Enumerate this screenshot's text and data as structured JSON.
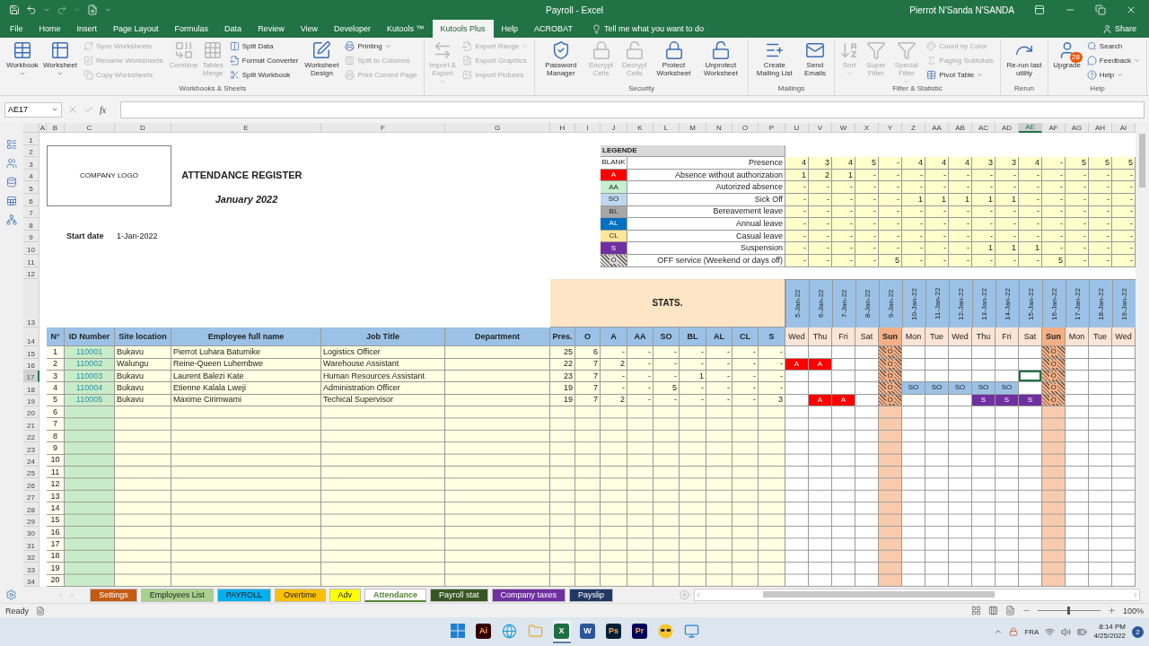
{
  "title_bar": {
    "title": "Payroll  -  Excel",
    "user": "Pierrot N'Sanda N'SANDA"
  },
  "menu_tabs": [
    {
      "label": "File",
      "selected": false
    },
    {
      "label": "Home",
      "selected": false
    },
    {
      "label": "Insert",
      "selected": false
    },
    {
      "label": "Page Layout",
      "selected": false
    },
    {
      "label": "Formulas",
      "selected": false
    },
    {
      "label": "Data",
      "selected": false
    },
    {
      "label": "Review",
      "selected": false
    },
    {
      "label": "View",
      "selected": false
    },
    {
      "label": "Developer",
      "selected": false
    },
    {
      "label": "Kutools ™",
      "selected": false
    },
    {
      "label": "Kutools Plus",
      "selected": true
    },
    {
      "label": "Help",
      "selected": false
    },
    {
      "label": "ACROBAT",
      "selected": false
    }
  ],
  "tell_me": "Tell me what you want to do",
  "share": "Share",
  "ribbon": [
    {
      "label": "Workbooks & Sheets",
      "controls": [
        {
          "kind": "large",
          "label": "Workbook",
          "disabled": false,
          "dropdown": true
        },
        {
          "kind": "large",
          "label": "Worksheet",
          "disabled": false,
          "dropdown": true
        },
        {
          "kind": "stack",
          "items": [
            {
              "label": "Sync Worksheets",
              "disabled": true,
              "dropdown": false
            },
            {
              "label": "Rename Worksheets",
              "disabled": true,
              "dropdown": false
            },
            {
              "label": "Copy Worksheets",
              "disabled": true,
              "dropdown": false
            }
          ]
        },
        {
          "kind": "large",
          "label": "Combine",
          "disabled": true,
          "dropdown": false
        },
        {
          "kind": "large",
          "label": "Tables Merge",
          "disabled": true,
          "dropdown": false
        },
        {
          "kind": "stack",
          "items": [
            {
              "label": "Split Data",
              "disabled": false,
              "dropdown": false
            },
            {
              "label": "Format Converter",
              "disabled": false,
              "dropdown": false
            },
            {
              "label": "Split Workbook",
              "disabled": false,
              "dropdown": false
            }
          ]
        },
        {
          "kind": "large",
          "label": "Worksheet Design",
          "disabled": false,
          "dropdown": false
        },
        {
          "kind": "stack",
          "items": [
            {
              "label": "Printing",
              "disabled": false,
              "dropdown": true
            },
            {
              "label": "Split to Columns",
              "disabled": true,
              "dropdown": false
            },
            {
              "label": "Print Current Page",
              "disabled": true,
              "dropdown": false
            }
          ]
        }
      ]
    },
    {
      "controls": [
        {
          "kind": "large",
          "label": "Import & Export",
          "disabled": true,
          "dropdown": true
        },
        {
          "kind": "stack",
          "items": [
            {
              "label": "Export Range",
              "disabled": true,
              "dropdown": true
            },
            {
              "label": "Export Graphics",
              "disabled": true,
              "dropdown": false
            },
            {
              "label": "Import Pictures",
              "disabled": true,
              "dropdown": false
            }
          ]
        }
      ]
    },
    {
      "label": "Security",
      "controls": [
        {
          "kind": "large",
          "label": "Password Manager",
          "disabled": false,
          "dropdown": false
        },
        {
          "kind": "large",
          "label": "Encrypt Cells",
          "disabled": true,
          "dropdown": false
        },
        {
          "kind": "large",
          "label": "Decrypt Cells",
          "disabled": true,
          "dropdown": false
        },
        {
          "kind": "large",
          "label": "Protect Worksheet",
          "disabled": false,
          "dropdown": false
        },
        {
          "kind": "large",
          "label": "Unprotect Worksheet",
          "disabled": false,
          "dropdown": false
        }
      ]
    },
    {
      "label": "Mailings",
      "controls": [
        {
          "kind": "large",
          "label": "Create Mailing List",
          "disabled": false,
          "dropdown": false
        },
        {
          "kind": "large",
          "label": "Send Emails",
          "disabled": false,
          "dropdown": false
        }
      ]
    },
    {
      "label": "Filter & Statistic",
      "controls": [
        {
          "kind": "large",
          "label": "Sort",
          "disabled": true,
          "dropdown": true
        },
        {
          "kind": "large",
          "label": "Super Filter",
          "disabled": true,
          "dropdown": false
        },
        {
          "kind": "large",
          "label": "Special Filter",
          "disabled": true,
          "dropdown": true
        },
        {
          "kind": "stack",
          "items": [
            {
              "label": "Count by Color",
              "disabled": true,
              "dropdown": false
            },
            {
              "label": "Paging Subtotals",
              "disabled": true,
              "dropdown": false
            },
            {
              "label": "Pivot Table",
              "disabled": false,
              "dropdown": true
            }
          ]
        }
      ]
    },
    {
      "label": "Rerun",
      "controls": [
        {
          "kind": "large",
          "label": "Re-run last utility",
          "disabled": false,
          "dropdown": false
        }
      ]
    },
    {
      "label": "Help",
      "controls": [
        {
          "kind": "large",
          "label": "Upgrade",
          "disabled": false,
          "dropdown": false,
          "badge": "28"
        },
        {
          "kind": "stack",
          "items": [
            {
              "label": "Search",
              "disabled": false,
              "dropdown": false
            },
            {
              "label": "Feedback",
              "disabled": false,
              "dropdown": true
            },
            {
              "label": "Help",
              "disabled": false,
              "dropdown": true
            }
          ]
        }
      ]
    }
  ],
  "formula_bar": {
    "name_box": "AE17",
    "function_label": "fx"
  },
  "sheet": {
    "column_headers": [
      {
        "label": "A",
        "selected": false
      },
      {
        "label": "B",
        "selected": false
      },
      {
        "label": "C",
        "selected": false
      },
      {
        "label": "D",
        "selected": false
      },
      {
        "label": "E",
        "selected": false
      },
      {
        "label": "F",
        "selected": false
      },
      {
        "label": "G",
        "selected": false
      },
      {
        "label": "H",
        "selected": false
      },
      {
        "label": "I",
        "selected": false
      },
      {
        "label": "J",
        "selected": false
      },
      {
        "label": "K",
        "selected": false
      },
      {
        "label": "L",
        "selected": false
      },
      {
        "label": "M",
        "selected": false
      },
      {
        "label": "N",
        "selected": false
      },
      {
        "label": "O",
        "selected": false
      },
      {
        "label": "P",
        "selected": false
      },
      {
        "label": "U",
        "selected": false
      },
      {
        "label": "V",
        "selected": false
      },
      {
        "label": "W",
        "selected": false
      },
      {
        "label": "X",
        "selected": false
      },
      {
        "label": "Y",
        "selected": false
      },
      {
        "label": "Z",
        "selected": false
      },
      {
        "label": "AA",
        "selected": false
      },
      {
        "label": "AB",
        "selected": false
      },
      {
        "label": "AC",
        "selected": false
      },
      {
        "label": "AD",
        "selected": false
      },
      {
        "label": "AE",
        "selected": true
      },
      {
        "label": "AF",
        "selected": false
      },
      {
        "label": "AG",
        "selected": false
      },
      {
        "label": "AH",
        "selected": false
      },
      {
        "label": "AI",
        "selected": false
      }
    ],
    "row_headers": [
      {
        "label": "1",
        "selected": false
      },
      {
        "label": "2",
        "selected": false
      },
      {
        "label": "3",
        "selected": false
      },
      {
        "label": "4",
        "selected": false
      },
      {
        "label": "5",
        "selected": false
      },
      {
        "label": "6",
        "selected": false
      },
      {
        "label": "7",
        "selected": false
      },
      {
        "label": "8",
        "selected": false
      },
      {
        "label": "9",
        "selected": false
      },
      {
        "label": "10",
        "selected": false
      },
      {
        "label": "11",
        "selected": false
      },
      {
        "label": "12",
        "selected": false
      },
      {
        "label": "13",
        "selected": false
      },
      {
        "label": "14",
        "selected": false
      },
      {
        "label": "15",
        "selected": false
      },
      {
        "label": "16",
        "selected": false
      },
      {
        "label": "17",
        "selected": true
      },
      {
        "label": "18",
        "selected": false
      },
      {
        "label": "19",
        "selected": false
      },
      {
        "label": "20",
        "selected": false
      },
      {
        "label": "21",
        "selected": false
      },
      {
        "label": "22",
        "selected": false
      },
      {
        "label": "23",
        "selected": false
      },
      {
        "label": "24",
        "selected": false
      },
      {
        "label": "25",
        "selected": false
      },
      {
        "label": "26",
        "selected": false
      },
      {
        "label": "27",
        "selected": false
      },
      {
        "label": "28",
        "selected": false
      },
      {
        "label": "29",
        "selected": false
      },
      {
        "label": "30",
        "selected": false
      },
      {
        "label": "31",
        "selected": false
      },
      {
        "label": "32",
        "selected": false
      },
      {
        "label": "33",
        "selected": false
      },
      {
        "label": "34",
        "selected": false
      }
    ],
    "logo": "COMPANY LOGO",
    "title": "ATTENDANCE REGISTER",
    "month": "January 2022",
    "start_date_label": "Start date",
    "start_date": "1-Jan-2022",
    "legend": {
      "title": "LEGENDE",
      "items": [
        {
          "code": "BLANK",
          "label": "Presence",
          "kind": "solid",
          "color": "#ffffff",
          "counts": [
            "4",
            "3",
            "4",
            "5",
            "-",
            "4",
            "4",
            "4",
            "3",
            "3",
            "4",
            "-",
            "5",
            "5",
            "5"
          ]
        },
        {
          "code": "A",
          "label": "Absence without authorization",
          "kind": "solid",
          "color": "#ff0000",
          "counts": [
            "1",
            "2",
            "1",
            "-",
            "-",
            "-",
            "-",
            "-",
            "-",
            "-",
            "-",
            "-",
            "-",
            "-",
            "-"
          ]
        },
        {
          "code": "AA",
          "label": "Autorized absence",
          "kind": "solid",
          "color": "#c6efce",
          "counts": [
            "-",
            "-",
            "-",
            "-",
            "-",
            "-",
            "-",
            "-",
            "-",
            "-",
            "-",
            "-",
            "-",
            "-",
            "-"
          ]
        },
        {
          "code": "SO",
          "label": "Sick Off",
          "kind": "solid",
          "color": "#bdd7ee",
          "counts": [
            "-",
            "-",
            "-",
            "-",
            "-",
            "1",
            "1",
            "1",
            "1",
            "1",
            "-",
            "-",
            "-",
            "-",
            "-"
          ]
        },
        {
          "code": "BL",
          "label": "Bereavement leave",
          "kind": "solid",
          "color": "#a6a6a6",
          "counts": [
            "-",
            "-",
            "-",
            "-",
            "-",
            "-",
            "-",
            "-",
            "-",
            "-",
            "-",
            "-",
            "-",
            "-",
            "-"
          ]
        },
        {
          "code": "AL",
          "label": "Annual leave",
          "kind": "solid",
          "color": "#0070c0",
          "counts": [
            "-",
            "-",
            "-",
            "-",
            "-",
            "-",
            "-",
            "-",
            "-",
            "-",
            "-",
            "-",
            "-",
            "-",
            "-"
          ]
        },
        {
          "code": "CL",
          "label": "Casual leave",
          "kind": "solid",
          "color": "#ffe699",
          "counts": [
            "-",
            "-",
            "-",
            "-",
            "-",
            "-",
            "-",
            "-",
            "-",
            "-",
            "-",
            "-",
            "-",
            "-",
            "-"
          ]
        },
        {
          "code": "S",
          "label": "Suspension",
          "kind": "solid",
          "color": "#7030a0",
          "counts": [
            "-",
            "-",
            "-",
            "-",
            "-",
            "-",
            "-",
            "-",
            "1",
            "1",
            "1",
            "-",
            "-",
            "-",
            "-"
          ]
        },
        {
          "code": "O",
          "label": "OFF service (Weekend or days off)",
          "kind": "hatched",
          "color": "#d9d9d9",
          "counts": [
            "-",
            "-",
            "-",
            "-",
            "5",
            "-",
            "-",
            "-",
            "-",
            "-",
            "-",
            "5",
            "-",
            "-",
            "-"
          ]
        }
      ]
    },
    "stats_title": "STATS.",
    "days": [
      {
        "date": "5-Jan-22",
        "day": "Wed",
        "weekend": false
      },
      {
        "date": "6-Jan-22",
        "day": "Thu",
        "weekend": false
      },
      {
        "date": "7-Jan-22",
        "day": "Fri",
        "weekend": false
      },
      {
        "date": "8-Jan-22",
        "day": "Sat",
        "weekend": false
      },
      {
        "date": "9-Jan-22",
        "day": "Sun",
        "weekend": true
      },
      {
        "date": "10-Jan-22",
        "day": "Mon",
        "weekend": false
      },
      {
        "date": "11-Jan-22",
        "day": "Tue",
        "weekend": false
      },
      {
        "date": "12-Jan-22",
        "day": "Wed",
        "weekend": false
      },
      {
        "date": "13-Jan-22",
        "day": "Thu",
        "weekend": false
      },
      {
        "date": "14-Jan-22",
        "day": "Fri",
        "weekend": false
      },
      {
        "date": "15-Jan-22",
        "day": "Sat",
        "weekend": false
      },
      {
        "date": "16-Jan-22",
        "day": "Sun",
        "weekend": true
      },
      {
        "date": "17-Jan-22",
        "day": "Mon",
        "weekend": false
      },
      {
        "date": "18-Jan-22",
        "day": "Tue",
        "weekend": false
      },
      {
        "date": "19-Jan-22",
        "day": "Wed",
        "weekend": false
      }
    ],
    "columns": [
      "N°",
      "ID Number",
      "Site location",
      "Employee full name",
      "Job Title",
      "Department",
      "Pres.",
      "O",
      "A",
      "AA",
      "SO",
      "BL",
      "AL",
      "CL",
      "S"
    ],
    "employees": [
      {
        "number": "1",
        "id": "110001",
        "site": "Bukavu",
        "name": "Pierrot Luhara Batumike",
        "job": "Logistics Officer",
        "stats": [
          "25",
          "6",
          "-",
          "-",
          "-",
          "-",
          "-",
          "-",
          "-"
        ],
        "attendance": [
          {
            "kind": "blank"
          },
          {
            "kind": "blank"
          },
          {
            "kind": "blank"
          },
          {
            "kind": "blank"
          },
          {
            "code": "O",
            "kind": "hatched",
            "color": "#f4b084"
          },
          {
            "kind": "blank"
          },
          {
            "kind": "blank"
          },
          {
            "kind": "blank"
          },
          {
            "kind": "blank"
          },
          {
            "kind": "blank"
          },
          {
            "kind": "blank"
          },
          {
            "code": "O",
            "kind": "hatched",
            "color": "#f4b084"
          },
          {
            "kind": "blank"
          },
          {
            "kind": "blank"
          },
          {
            "kind": "blank"
          }
        ]
      },
      {
        "number": "2",
        "id": "110002",
        "site": "Walungu",
        "name": "Reine-Queen Luhembwe",
        "job": "Warehouse Assistant",
        "stats": [
          "22",
          "7",
          "2",
          "-",
          "-",
          "-",
          "-",
          "-",
          "-"
        ],
        "attendance": [
          {
            "code": "A",
            "kind": "solid",
            "color": "#ff0000"
          },
          {
            "code": "A",
            "kind": "solid",
            "color": "#ff0000"
          },
          {
            "kind": "blank"
          },
          {
            "kind": "blank"
          },
          {
            "code": "O",
            "kind": "hatched",
            "color": "#f4b084"
          },
          {
            "kind": "blank"
          },
          {
            "kind": "blank"
          },
          {
            "kind": "blank"
          },
          {
            "kind": "blank"
          },
          {
            "kind": "blank"
          },
          {
            "kind": "blank"
          },
          {
            "code": "O",
            "kind": "hatched",
            "color": "#f4b084"
          },
          {
            "kind": "blank"
          },
          {
            "kind": "blank"
          },
          {
            "kind": "blank"
          }
        ]
      },
      {
        "number": "3",
        "id": "110003",
        "site": "Bukavu",
        "name": "Laurent Balezi Kate",
        "job": "Human Resources Assistant",
        "stats": [
          "23",
          "7",
          "-",
          "-",
          "-",
          "1",
          "-",
          "-",
          "-"
        ],
        "attendance": [
          {
            "kind": "blank"
          },
          {
            "kind": "blank"
          },
          {
            "kind": "blank"
          },
          {
            "kind": "blank"
          },
          {
            "code": "O",
            "kind": "hatched",
            "color": "#f4b084"
          },
          {
            "kind": "blank"
          },
          {
            "kind": "blank"
          },
          {
            "kind": "blank"
          },
          {
            "kind": "blank"
          },
          {
            "kind": "blank"
          },
          {
            "kind": "blank"
          },
          {
            "code": "O",
            "kind": "hatched",
            "color": "#f4b084"
          },
          {
            "kind": "blank"
          },
          {
            "kind": "blank"
          },
          {
            "kind": "blank"
          }
        ]
      },
      {
        "number": "4",
        "id": "110004",
        "site": "Bukavu",
        "name": "Etienne Kalala Lweji",
        "job": "Administration Officer",
        "stats": [
          "19",
          "7",
          "-",
          "-",
          "5",
          "-",
          "-",
          "-",
          "-"
        ],
        "attendance": [
          {
            "kind": "blank"
          },
          {
            "kind": "blank"
          },
          {
            "kind": "blank"
          },
          {
            "kind": "blank"
          },
          {
            "code": "O",
            "kind": "hatched",
            "color": "#f4b084"
          },
          {
            "code": "SO",
            "kind": "solid",
            "color": "#9bc2e6"
          },
          {
            "code": "SO",
            "kind": "solid",
            "color": "#9bc2e6"
          },
          {
            "code": "SO",
            "kind": "solid",
            "color": "#9bc2e6"
          },
          {
            "code": "SO",
            "kind": "solid",
            "color": "#9bc2e6"
          },
          {
            "code": "SO",
            "kind": "solid",
            "color": "#9bc2e6"
          },
          {
            "kind": "blank"
          },
          {
            "code": "O",
            "kind": "hatched",
            "color": "#f4b084"
          },
          {
            "kind": "blank"
          },
          {
            "kind": "blank"
          },
          {
            "kind": "blank"
          }
        ]
      },
      {
        "number": "5",
        "id": "110005",
        "site": "Bukavu",
        "name": "Maxime Cirimwami",
        "job": "Techical Supervisor",
        "stats": [
          "19",
          "7",
          "2",
          "-",
          "-",
          "-",
          "-",
          "-",
          "3"
        ],
        "attendance": [
          {
            "kind": "blank"
          },
          {
            "code": "A",
            "kind": "solid",
            "color": "#ff0000"
          },
          {
            "code": "A",
            "kind": "solid",
            "color": "#ff0000"
          },
          {
            "kind": "blank"
          },
          {
            "code": "O",
            "kind": "hatched",
            "color": "#f4b084"
          },
          {
            "kind": "blank"
          },
          {
            "kind": "blank"
          },
          {
            "kind": "blank"
          },
          {
            "code": "S",
            "kind": "solid",
            "color": "#7030a0"
          },
          {
            "code": "S",
            "kind": "solid",
            "color": "#7030a0"
          },
          {
            "code": "S",
            "kind": "solid",
            "color": "#7030a0"
          },
          {
            "code": "O",
            "kind": "hatched",
            "color": "#f4b084"
          },
          {
            "kind": "blank"
          },
          {
            "kind": "blank"
          },
          {
            "kind": "blank"
          }
        ]
      }
    ],
    "blank_rows": [
      "6",
      "7",
      "8",
      "9",
      "10",
      "11",
      "12",
      "13",
      "14",
      "15",
      "16",
      "17",
      "18",
      "19",
      "20"
    ]
  },
  "sheet_tabs": [
    {
      "label": "Settings",
      "color": "#c55a11",
      "selected": false
    },
    {
      "label": "Employees List",
      "color": "#a9d08e",
      "selected": false
    },
    {
      "label": "PAYROLL",
      "color": "#00b0f0",
      "selected": false
    },
    {
      "label": "Overtime",
      "color": "#ffc000",
      "selected": false
    },
    {
      "label": "Adv",
      "color": "#ffff00",
      "selected": false
    },
    {
      "label": "Attendance",
      "color": "#548235",
      "selected": true
    },
    {
      "label": "Payroll stat",
      "color": "#375623",
      "selected": false
    },
    {
      "label": "Company taxes",
      "color": "#7030a0",
      "selected": false
    },
    {
      "label": "Payslip",
      "color": "#203864",
      "selected": false
    }
  ],
  "status": {
    "text": "Ready",
    "zoom": "100%",
    "zoom_slider": {
      "level": 0.5
    }
  },
  "taskbar": {
    "apps": [
      {
        "kind": "start",
        "active": false
      },
      {
        "kind": "tile",
        "label": "Ai",
        "color": "#330000",
        "active": false
      },
      {
        "kind": "edge",
        "active": false
      },
      {
        "kind": "folder",
        "active": false
      },
      {
        "kind": "tile",
        "label": "X",
        "color": "#1d6f42",
        "active": true
      },
      {
        "kind": "tile",
        "label": "W",
        "color": "#2b579a",
        "active": false
      },
      {
        "kind": "tile",
        "label": "Ps",
        "color": "#001e36",
        "active": false
      },
      {
        "kind": "tile",
        "label": "Pr",
        "color": "#00005b",
        "active": false
      },
      {
        "kind": "emoji",
        "active": false
      },
      {
        "kind": "monitor",
        "active": false
      }
    ],
    "language": "FRA",
    "time": "8:14 PM",
    "date": "4/25/2022",
    "notifications": "2"
  }
}
